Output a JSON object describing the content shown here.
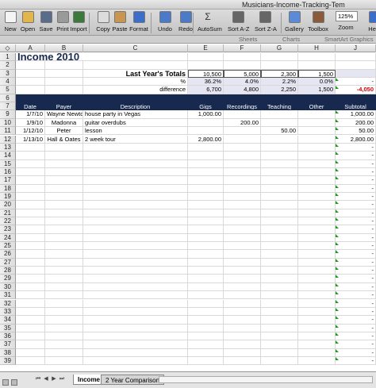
{
  "window": {
    "title": "Musicians-Income-Tracking-Tem"
  },
  "toolbar": {
    "items": [
      {
        "label": "New",
        "icon": "new-icon",
        "color": "#f4f4f4"
      },
      {
        "label": "Open",
        "icon": "open-icon",
        "color": "#e2b64a"
      },
      {
        "label": "Save",
        "icon": "save-icon",
        "color": "#5a6c8c"
      },
      {
        "label": "Print",
        "icon": "print-icon",
        "color": "#9a9a9a"
      },
      {
        "label": "Import",
        "icon": "import-icon",
        "color": "#3c7a3c"
      },
      {
        "label": "Copy",
        "icon": "copy-icon",
        "color": "#dcdcdc"
      },
      {
        "label": "Paste",
        "icon": "paste-icon",
        "color": "#c89650"
      },
      {
        "label": "Format",
        "icon": "format-icon",
        "color": "#3a6ec8"
      },
      {
        "label": "Undo",
        "icon": "undo-icon",
        "color": "#4a7ac8"
      },
      {
        "label": "Redo",
        "icon": "redo-icon",
        "color": "#4a7ac8"
      },
      {
        "label": "AutoSum",
        "icon": "autosum-icon",
        "color": "#555555"
      },
      {
        "label": "Sort A-Z",
        "icon": "sort-az-icon",
        "color": "#666666"
      },
      {
        "label": "Sort Z-A",
        "icon": "sort-za-icon",
        "color": "#666666"
      },
      {
        "label": "Gallery",
        "icon": "gallery-icon",
        "color": "#5a8ad8"
      },
      {
        "label": "Toolbox",
        "icon": "toolbox-icon",
        "color": "#8a5a3a"
      },
      {
        "label": "Zoom",
        "icon": "zoom-icon",
        "color": "#ffffff"
      },
      {
        "label": "Help",
        "icon": "help-icon",
        "color": "#3a6ec8"
      }
    ],
    "zoom_value": "125%"
  },
  "ribbon": {
    "sheets": "Sheets",
    "charts": "Charts",
    "smartart": "SmartArt Graphics"
  },
  "columns": [
    "A",
    "B",
    "C",
    "E",
    "F",
    "G",
    "H",
    "J"
  ],
  "sheet": {
    "title": "Income 2010",
    "summary": {
      "totals_label": "Last Year's Totals",
      "percent_label": "%",
      "difference_label": "difference",
      "totals": [
        "10,500",
        "5,000",
        "2,300",
        "1,500"
      ],
      "percent": [
        "36.2%",
        "4.0%",
        "2.2%",
        "0.0%"
      ],
      "difference": [
        "6,700",
        "4,800",
        "2,250",
        "1,500"
      ],
      "percent_j": "-",
      "difference_j": "-4,050"
    },
    "headers": [
      "Date",
      "Payer",
      "Description",
      "Gigs",
      "Recordings",
      "Teaching",
      "Other",
      "Subtotal"
    ],
    "entries": [
      {
        "date": "1/7/10",
        "payer": "Wayne Newton",
        "desc": "house party in Vegas",
        "gigs": "1,000.00",
        "rec": "",
        "teach": "",
        "other": "",
        "subtotal": "1,000.00"
      },
      {
        "date": "1/9/10",
        "payer": "Madonna",
        "desc": "guitar overdubs",
        "gigs": "",
        "rec": "200.00",
        "teach": "",
        "other": "",
        "subtotal": "200.00"
      },
      {
        "date": "1/12/10",
        "payer": "Peter",
        "desc": "lesson",
        "gigs": "",
        "rec": "",
        "teach": "50.00",
        "other": "",
        "subtotal": "50.00"
      },
      {
        "date": "1/13/10",
        "payer": "Hall & Oates",
        "desc": "2 week tour",
        "gigs": "2,800.00",
        "rec": "",
        "teach": "",
        "other": "",
        "subtotal": "2,800.00"
      }
    ],
    "empty_row_subtotal": "-"
  },
  "row_numbers": [
    "1",
    "2",
    "3",
    "4",
    "5",
    "6",
    "7",
    "9",
    "10",
    "11",
    "12",
    "13",
    "14",
    "15",
    "16",
    "17",
    "18",
    "19",
    "20",
    "21",
    "22",
    "23",
    "24",
    "25",
    "26",
    "27",
    "28",
    "29",
    "30",
    "31",
    "32",
    "33",
    "34",
    "35",
    "36",
    "37",
    "38",
    "39"
  ],
  "tabs": {
    "income": "Income",
    "comparison": "2 Year Comparison"
  },
  "colors": {
    "header_blue": "#17294f",
    "negative_red": "#d40000",
    "shade": "#e6e6f2"
  }
}
